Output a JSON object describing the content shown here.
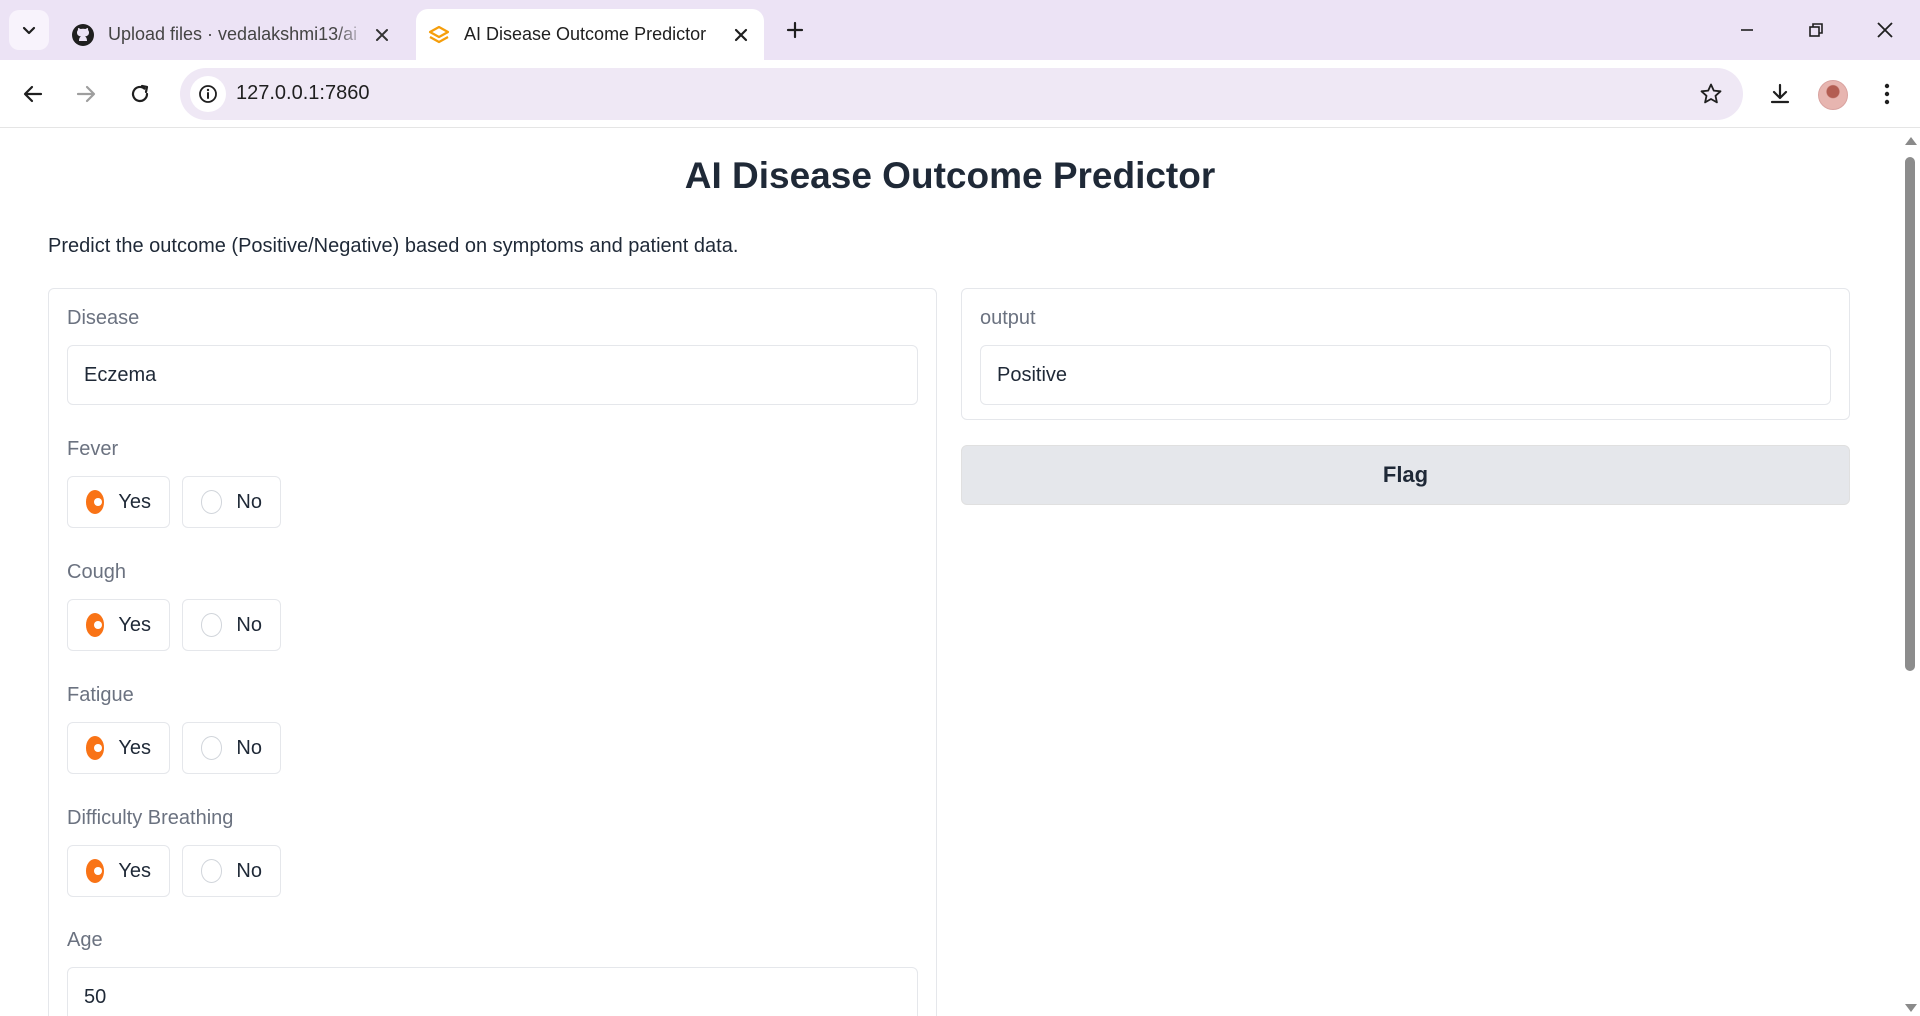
{
  "browser": {
    "tabs": [
      {
        "title": "Upload files · vedalakshmi13/ai",
        "icon": "github-icon",
        "active": false
      },
      {
        "title": "AI Disease Outcome Predictor",
        "icon": "gradio-logo-icon",
        "active": true
      }
    ],
    "url": "127.0.0.1:7860",
    "accent_colors": {
      "tabbar": "#ece3f5",
      "omnibox": "#efe8f5"
    }
  },
  "app": {
    "title": "AI Disease Outcome Predictor",
    "description": "Predict the outcome (Positive/Negative) based on symptoms and patient data.",
    "inputs": {
      "disease": {
        "label": "Disease",
        "value": "Eczema"
      },
      "fever": {
        "label": "Fever",
        "options": [
          "Yes",
          "No"
        ],
        "selected": "Yes"
      },
      "cough": {
        "label": "Cough",
        "options": [
          "Yes",
          "No"
        ],
        "selected": "Yes"
      },
      "fatigue": {
        "label": "Fatigue",
        "options": [
          "Yes",
          "No"
        ],
        "selected": "Yes"
      },
      "difficulty_breathing": {
        "label": "Difficulty Breathing",
        "options": [
          "Yes",
          "No"
        ],
        "selected": "Yes"
      },
      "age": {
        "label": "Age",
        "value": "50"
      }
    },
    "output": {
      "label": "output",
      "value": "Positive"
    },
    "flag_label": "Flag",
    "accent_color": "#f97316"
  }
}
